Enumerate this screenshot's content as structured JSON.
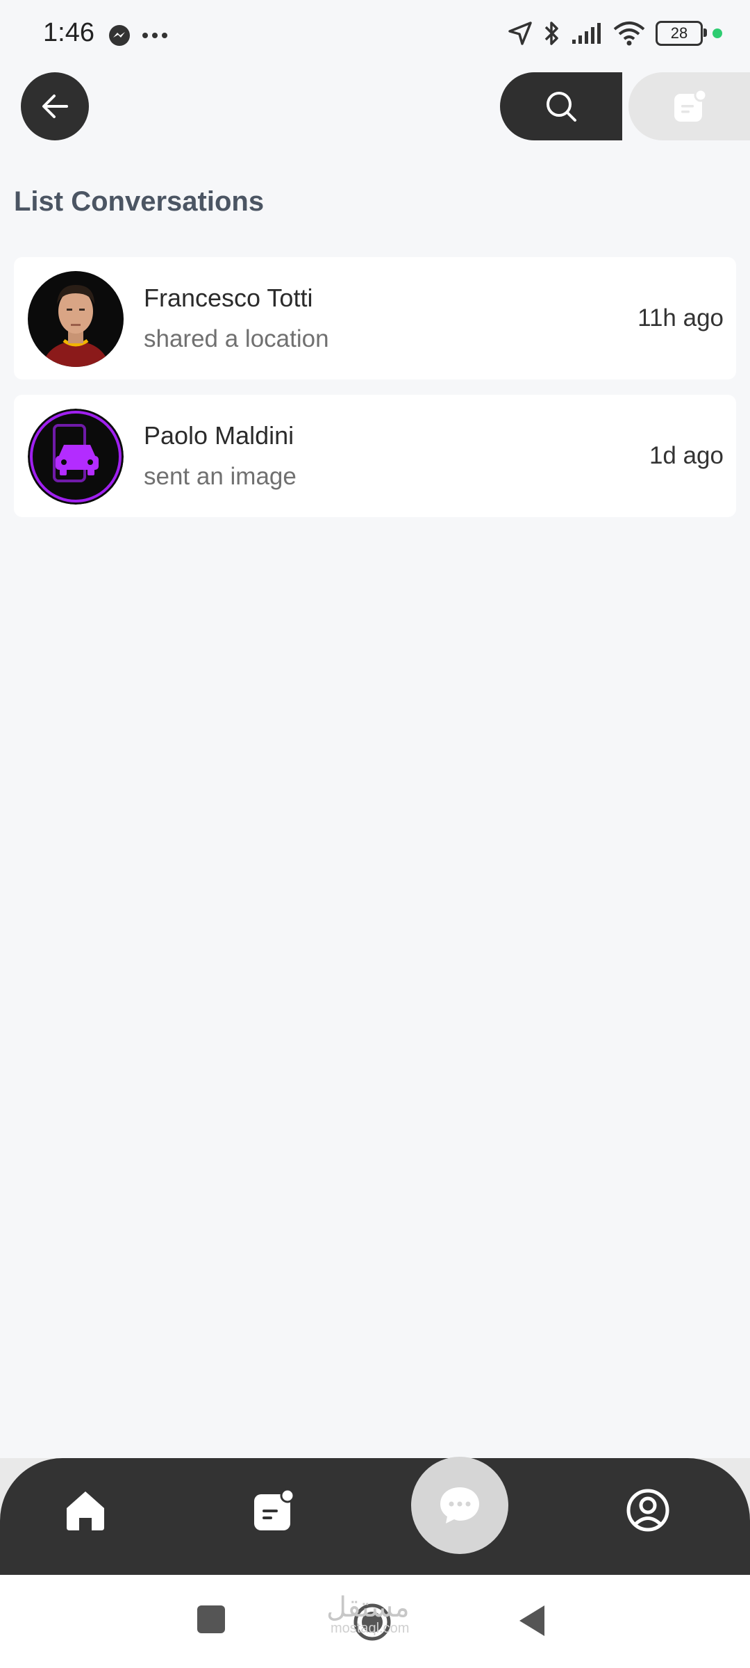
{
  "status_bar": {
    "time": "1:46",
    "battery_level": "28",
    "left_icons": [
      "messenger-icon",
      "more-dots-icon"
    ],
    "right_icons": [
      "location-arrow-icon",
      "bluetooth-icon",
      "signal-icon",
      "wifi-icon",
      "battery-icon",
      "green-dot-indicator"
    ]
  },
  "header": {
    "back_icon": "arrow-left-icon",
    "search_icon": "search-icon",
    "notes_icon": "note-badge-icon"
  },
  "page": {
    "title": "List Conversations"
  },
  "conversations": [
    {
      "name": "Francesco Totti",
      "message": "shared a location",
      "time": "11h ago",
      "avatar": "player-photo"
    },
    {
      "name": "Paolo Maldini",
      "message": "sent an image",
      "time": "1d ago",
      "avatar": "car-app-logo"
    }
  ],
  "bottom_nav": {
    "items": [
      {
        "icon": "home-icon"
      },
      {
        "icon": "note-badge-icon"
      },
      {
        "icon": "chat-bubble-icon",
        "active": true
      },
      {
        "icon": "profile-icon"
      }
    ]
  },
  "system_nav": {
    "items": [
      "recents-square-icon",
      "home-circle-icon",
      "back-triangle-icon"
    ],
    "watermark": "مستقل",
    "watermark_sub": "mostaql.com"
  },
  "colors": {
    "background": "#f6f7f9",
    "dark": "#2f2f2f",
    "accent_purple": "#a020f0",
    "status_green": "#2ecc71"
  }
}
